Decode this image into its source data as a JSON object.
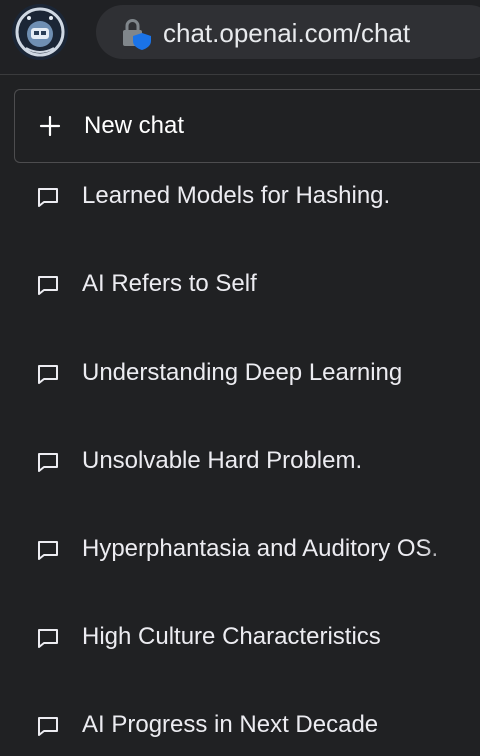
{
  "browser": {
    "url": "chat.openai.com/chat",
    "lock_icon": "lock-icon",
    "avatar_icon": "avatar-icon"
  },
  "sidebar": {
    "new_chat": {
      "label": "New chat",
      "icon": "plus-icon"
    },
    "chats": [
      {
        "label": "Learned Models for Hashing.",
        "icon": "message-icon"
      },
      {
        "label": "AI Refers to Self",
        "icon": "message-icon"
      },
      {
        "label": "Understanding Deep Learning",
        "icon": "message-icon"
      },
      {
        "label": "Unsolvable Hard Problem.",
        "icon": "message-icon"
      },
      {
        "label": "Hyperphantasia and Auditory OS.",
        "icon": "message-icon"
      },
      {
        "label": "High Culture Characteristics",
        "icon": "message-icon"
      },
      {
        "label": "AI Progress in Next Decade",
        "icon": "message-icon"
      }
    ]
  },
  "colors": {
    "background": "#202123",
    "border": "#4d4d4f",
    "text": "#ececf1",
    "urlbar": "#2f3034",
    "lock_badge": "#1a73e8"
  }
}
